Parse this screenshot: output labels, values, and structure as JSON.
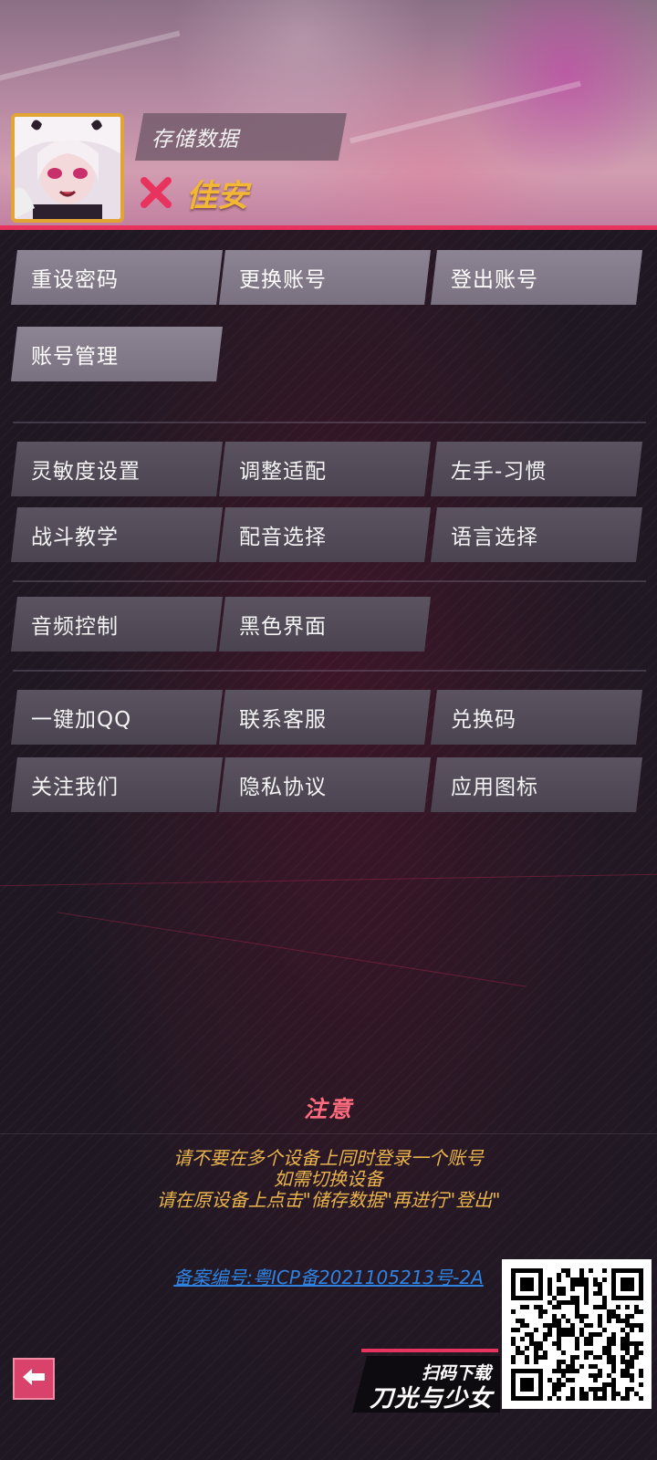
{
  "profile": {
    "save_label": "存储数据",
    "username": "佳安",
    "status_color": "#e8335f",
    "name_color": "#f2b733"
  },
  "account_buttons": [
    {
      "label": "重设密码"
    },
    {
      "label": "更换账号"
    },
    {
      "label": "登出账号"
    },
    {
      "label": "账号管理"
    }
  ],
  "settings_buttons": [
    {
      "label": "灵敏度设置"
    },
    {
      "label": "调整适配"
    },
    {
      "label": "左手-习惯"
    },
    {
      "label": "战斗教学"
    },
    {
      "label": "配音选择"
    },
    {
      "label": "语言选择"
    }
  ],
  "display_buttons": [
    {
      "label": "音频控制"
    },
    {
      "label": "黑色界面"
    }
  ],
  "social_buttons": [
    {
      "label": "一键加QQ"
    },
    {
      "label": "联系客服"
    },
    {
      "label": "兑换码"
    },
    {
      "label": "关注我们"
    },
    {
      "label": "隐私协议"
    },
    {
      "label": "应用图标"
    }
  ],
  "notice": {
    "title": "注意",
    "lines": [
      "请不要在多个设备上同时登录一个账号",
      "如需切换设备",
      "请在原设备上点击\"储存数据\"再进行\"登出\""
    ],
    "title_color": "#ff6c7e",
    "text_color": "#e9b44c"
  },
  "footer": {
    "icp": "备案编号:粤ICP备2021105213号-2A",
    "scan_label": "扫码下载",
    "game_name": "刀光与少女"
  },
  "icons": {
    "back": "back-arrow-icon",
    "close": "close-icon",
    "avatar": "avatar"
  }
}
